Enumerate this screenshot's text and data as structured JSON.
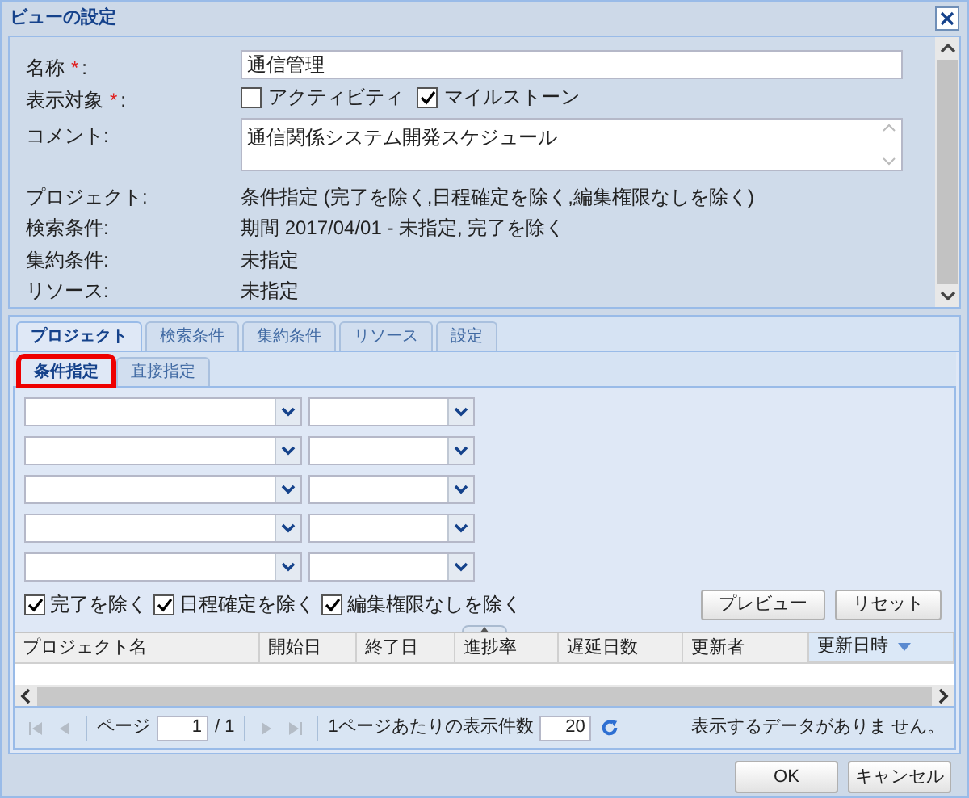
{
  "window": {
    "title": "ビューの設定"
  },
  "form": {
    "name": {
      "label": "名称",
      "marker": "*",
      "suffix": ":",
      "value": "通信管理"
    },
    "display_target": {
      "label": "表示対象",
      "marker": "*",
      "suffix": ":",
      "options": [
        {
          "label": "アクティビティ",
          "checked": false
        },
        {
          "label": "マイルストーン",
          "checked": true
        }
      ]
    },
    "comment": {
      "label": "コメント:",
      "value": "通信関係システム開発スケジュール"
    },
    "summary": [
      {
        "label": "プロジェクト:",
        "value": "条件指定 (完了を除く,日程確定を除く,編集権限なしを除く)"
      },
      {
        "label": "検索条件:",
        "value": "期間 2017/04/01 - 未指定, 完了を除く"
      },
      {
        "label": "集約条件:",
        "value": "未指定"
      },
      {
        "label": "リソース:",
        "value": "未指定"
      }
    ]
  },
  "tabs": [
    {
      "label": "プロジェクト",
      "selected": true
    },
    {
      "label": "検索条件",
      "selected": false
    },
    {
      "label": "集約条件",
      "selected": false
    },
    {
      "label": "リソース",
      "selected": false
    },
    {
      "label": "設定",
      "selected": false
    }
  ],
  "sub_tabs": [
    {
      "label": "条件指定",
      "selected": true,
      "highlighted": true
    },
    {
      "label": "直接指定",
      "selected": false,
      "highlighted": false
    }
  ],
  "exclude_options": [
    {
      "label": "完了を除く",
      "checked": true
    },
    {
      "label": "日程確定を除く",
      "checked": true
    },
    {
      "label": "編集権限なしを除く",
      "checked": true
    }
  ],
  "buttons": [
    "プレビュー",
    "リセット"
  ],
  "grid": {
    "columns": [
      {
        "label": "プロジェクト名",
        "sorted": false
      },
      {
        "label": "開始日",
        "sorted": false
      },
      {
        "label": "終了日",
        "sorted": false
      },
      {
        "label": "進捗率",
        "sorted": false
      },
      {
        "label": "遅延日数",
        "sorted": false
      },
      {
        "label": "更新者",
        "sorted": false
      },
      {
        "label": "更新日時",
        "sorted": true
      }
    ]
  },
  "pager": {
    "page_label": "ページ",
    "page": "1",
    "total": "/ 1",
    "page_size_label": "1ページあたりの表示件数",
    "page_size": "20",
    "empty_message": "表示するデータがありま せん。"
  },
  "footer_buttons": [
    "OK",
    "キャンセル"
  ]
}
